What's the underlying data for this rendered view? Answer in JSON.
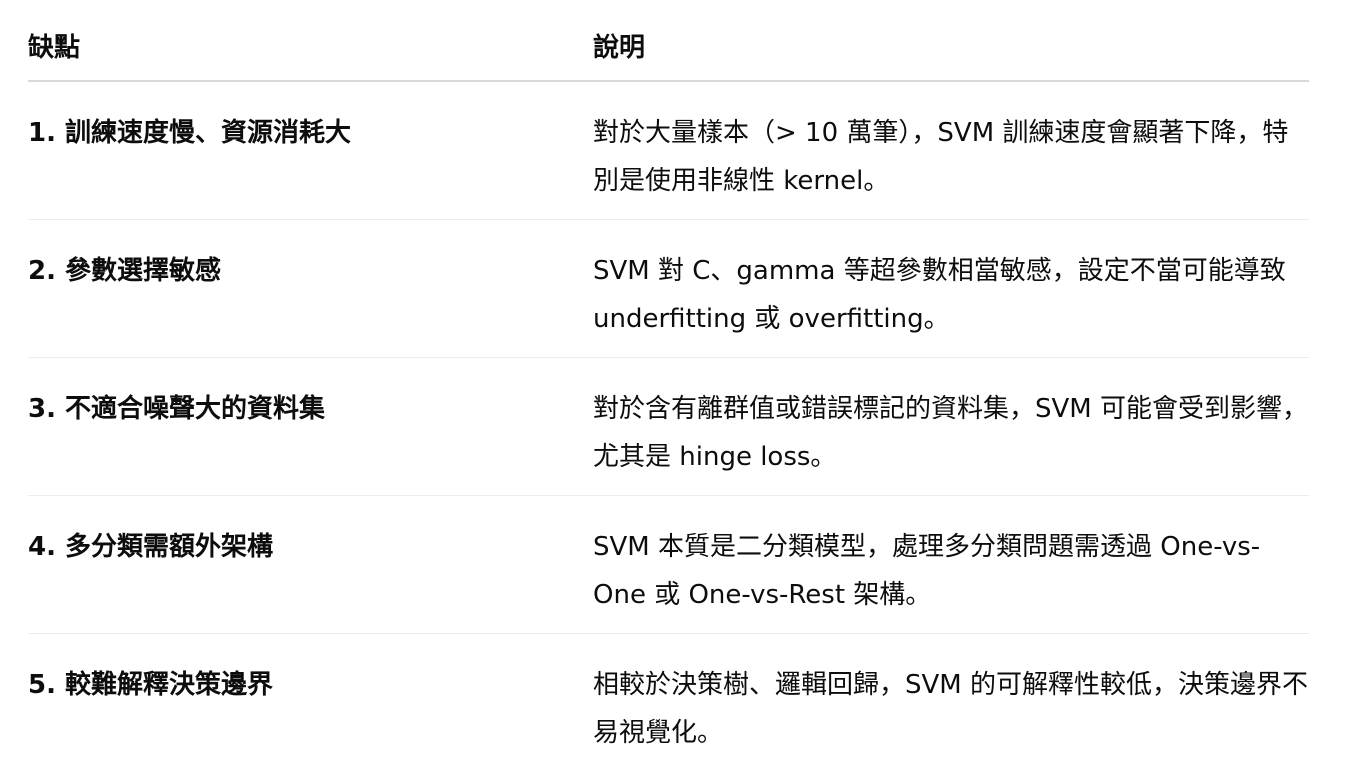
{
  "table": {
    "headers": [
      "缺點",
      "說明"
    ],
    "rows": [
      {
        "drawback": "1. 訓練速度慢、資源消耗大",
        "description": "對於大量樣本（> 10 萬筆），SVM 訓練速度會顯著下降，特別是使用非線性 kernel。"
      },
      {
        "drawback": "2. 參數選擇敏感",
        "description": "SVM 對 C、gamma 等超參數相當敏感，設定不當可能導致 underfitting 或 overfitting。"
      },
      {
        "drawback": "3. 不適合噪聲大的資料集",
        "description": "對於含有離群值或錯誤標記的資料集，SVM 可能會受到影響，尤其是 hinge loss。"
      },
      {
        "drawback": "4. 多分類需額外架構",
        "description": "SVM 本質是二分類模型，處理多分類問題需透過 One-vs-One 或 One-vs-Rest 架構。"
      },
      {
        "drawback": "5. 較難解釋決策邊界",
        "description": "相較於決策樹、邏輯回歸，SVM 的可解釋性較低，決策邊界不易視覺化。"
      }
    ]
  }
}
